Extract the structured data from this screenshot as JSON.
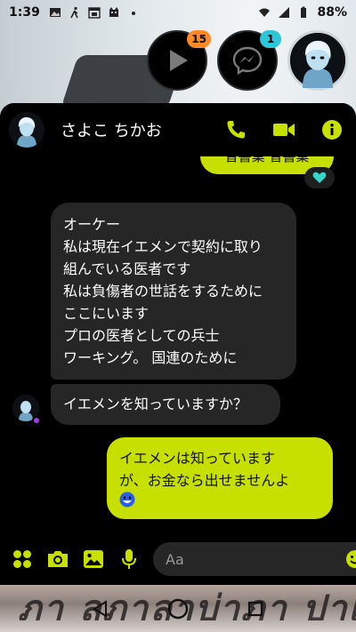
{
  "status_bar": {
    "time": "1:39",
    "battery": "88%"
  },
  "chat_heads": [
    {
      "name": "play-chat-head",
      "badge": "15",
      "badge_color": "#ff8a25"
    },
    {
      "name": "messenger-chat-head",
      "badge": "1",
      "badge_color": "#2ec6d9"
    },
    {
      "name": "contact-chat-head",
      "badge": ""
    }
  ],
  "conversation": {
    "contact_name": "さよこ ちかお",
    "messages": {
      "partial_outgoing": "音書業 音書業",
      "incoming_long": [
        "オーケー",
        "私は現在イエメンで契約に取り",
        "組んでいる医者です",
        "私は負傷者の世話をするために",
        "ここにいます",
        "プロの医者としての兵士",
        "ワーキング。 国連のために"
      ],
      "incoming_short": "イエメンを知っていますか？",
      "outgoing_lines": [
        "イエメンは知っています",
        "が、お金なら出せませんよ"
      ]
    },
    "composer": {
      "placeholder": "Aa"
    }
  },
  "background_text": "ภา ลภาลาบ่าภา ปาเ",
  "colors": {
    "accent": "#c8e000",
    "bubble_incoming": "#262626",
    "panel_bg": "#000000"
  },
  "icons": [
    "image-icon",
    "walk-icon",
    "calendar-icon",
    "cat-icon",
    "dot-icon",
    "wifi-icon",
    "signal-icon",
    "battery-icon",
    "phone-icon",
    "video-icon",
    "info-icon",
    "apps-icon",
    "camera-icon",
    "gallery-icon",
    "mic-icon",
    "emoji-icon",
    "thumbs-up-icon",
    "back-icon",
    "home-icon",
    "recents-icon"
  ]
}
